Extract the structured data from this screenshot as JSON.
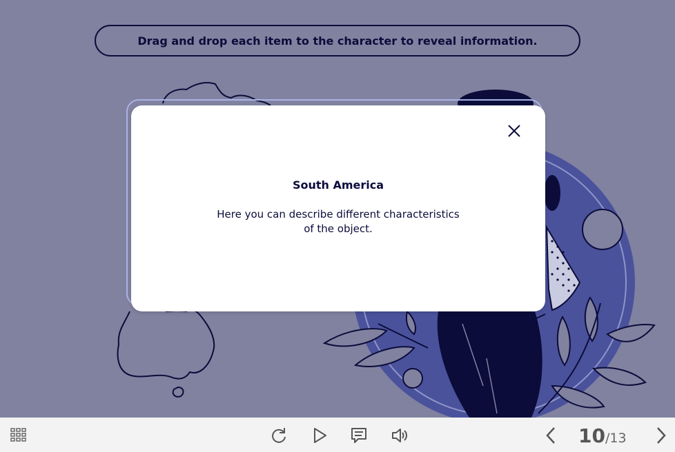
{
  "instruction": "Drag and drop each item to the character to reveal information.",
  "modal": {
    "title": "South America",
    "body_line1": "Here you can describe different characteristics",
    "body_line2": "of the object."
  },
  "toolbar": {
    "menu_icon": "grid-menu-icon",
    "replay_icon": "replay-icon",
    "play_icon": "play-icon",
    "notes_icon": "notes-icon",
    "volume_icon": "volume-icon",
    "prev_icon": "chevron-left-icon",
    "next_icon": "chevron-right-icon",
    "page_current": "10",
    "page_total": "/13"
  },
  "colors": {
    "background": "#8182a0",
    "navy": "#0b0c3a",
    "accent_circle": "#4b529c",
    "modal_border": "#aab3e6"
  }
}
